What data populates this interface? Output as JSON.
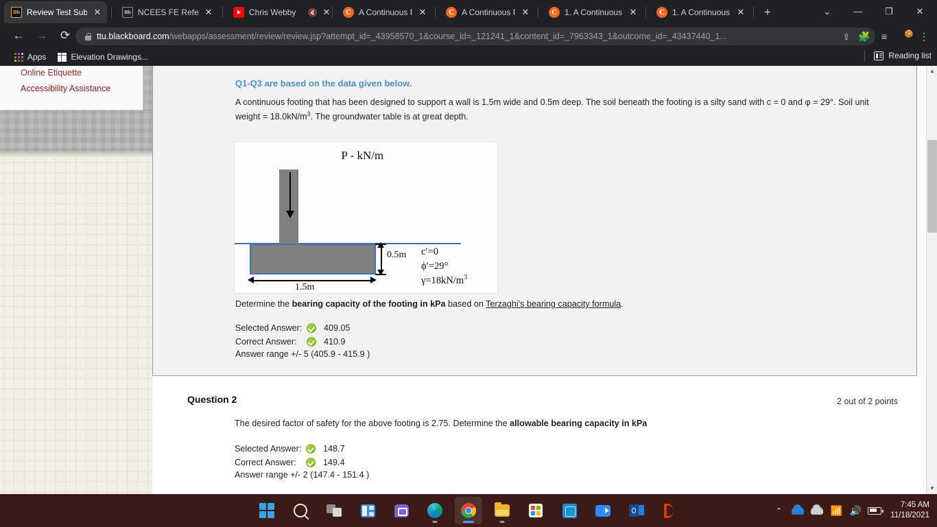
{
  "browser": {
    "tabs": [
      {
        "title": "Review Test Subm",
        "favicon": "blackboard-icon",
        "active": true,
        "muted": false
      },
      {
        "title": "NCEES FE Referen",
        "favicon": "blackboard-icon",
        "active": false,
        "muted": false
      },
      {
        "title": "Chris Webby",
        "favicon": "youtube-icon",
        "active": false,
        "muted": true
      },
      {
        "title": "A Continuous Fo",
        "favicon": "chegg-icon",
        "active": false,
        "muted": false
      },
      {
        "title": "A Continuous Fo",
        "favicon": "chegg-icon",
        "active": false,
        "muted": false
      },
      {
        "title": "1. A Continuous",
        "favicon": "chegg-icon",
        "active": false,
        "muted": false
      },
      {
        "title": "1. A Continuous",
        "favicon": "chegg-icon",
        "active": false,
        "muted": false
      }
    ],
    "new_tab_label": "+",
    "window_controls": {
      "more": "⌄",
      "minimize": "—",
      "maximize": "❐",
      "close": "✕"
    },
    "nav": {
      "back": "←",
      "forward": "→",
      "reload": "⟳"
    },
    "url": {
      "domain": "ttu.blackboard.com",
      "path": "/webapps/assessment/review/review.jsp?attempt_id=_43958570_1&course_id=_121241_1&content_id=_7963343_1&outcome_id=_43437440_1..."
    },
    "omnibox_icons": {
      "share": "⇪",
      "bookmark": "☆"
    },
    "toolbar_icons": {
      "extensions": "🧩",
      "reading": "≡♪",
      "menu": "⋮"
    },
    "bookmarks": [
      {
        "label": "Apps",
        "icon": "apps-grid-icon"
      },
      {
        "label": "Elevation Drawings...",
        "icon": "document-icon"
      }
    ],
    "reading_list": {
      "label": "Reading list",
      "icon": "reading-list-icon"
    }
  },
  "sidebar": {
    "links": [
      {
        "label": "Online Etiquette"
      },
      {
        "label": "Accessibility Assistance"
      }
    ]
  },
  "question1": {
    "heading": "Q1-Q3 are based on the data given below.",
    "body_part1": "A continuous footing that has been designed to support a wall is 1.5m wide and 0.5m deep. The soil beneath the footing is a silty sand with c = 0 and φ = 29°.   Soil unit weight = 18.0kN/m",
    "body_sup": "3",
    "body_part2": ".  The groundwater table is at great depth.",
    "determine_prefix": "Determine the ",
    "determine_bold": "bearing capacity of the footing in kPa",
    "determine_mid": " based on ",
    "determine_underline": "Terzaghi's bearing capacity formula",
    "determine_suffix": ".",
    "selected_answer_label": "Selected Answer:",
    "selected_answer_value": "409.05",
    "correct_answer_label": "Correct Answer:",
    "correct_answer_value": "410.9",
    "answer_range": "Answer range +/- 5 (405.9 - 415.9 )"
  },
  "figure": {
    "load_label": "P - kN/m",
    "depth_label": "0.5m",
    "width_label": "1.5m",
    "soil_cohesion": "c′=0",
    "soil_friction": "ϕ′=29°",
    "soil_unit_weight_prefix": "γ=18kN/m",
    "soil_unit_weight_sup": "3",
    "colors": {
      "concrete": "#808080",
      "outline": "#4472a8",
      "ground_line": "#4472a8"
    }
  },
  "question2": {
    "title": "Question 2",
    "points": "2 out of 2 points",
    "body_prefix": "The desired factor of safety for the above footing is 2.75.  Determine the ",
    "body_bold": "allowable bearing capacity in kPa",
    "selected_answer_label": "Selected Answer:",
    "selected_answer_value": "148.7",
    "correct_answer_label": "Correct Answer:",
    "correct_answer_value": "149.4",
    "answer_range": "Answer range +/- 2 (147.4 - 151.4 )"
  },
  "scrollbar": {
    "up": "▲",
    "down": "▼"
  },
  "taskbar": {
    "items": [
      {
        "name": "start-icon"
      },
      {
        "name": "search-icon"
      },
      {
        "name": "task-view-icon"
      },
      {
        "name": "widgets-icon"
      },
      {
        "name": "chat-icon"
      },
      {
        "name": "edge-icon"
      },
      {
        "name": "chrome-icon"
      },
      {
        "name": "file-explorer-icon"
      },
      {
        "name": "microsoft-store-icon"
      },
      {
        "name": "teams-icon"
      },
      {
        "name": "zoom-icon"
      },
      {
        "name": "outlook-icon"
      },
      {
        "name": "office-icon"
      }
    ],
    "tray": {
      "chevron": "⌃",
      "wifi": "⌁",
      "volume": "🔊"
    },
    "time": "7:45 AM",
    "date": "11/18/2021"
  }
}
